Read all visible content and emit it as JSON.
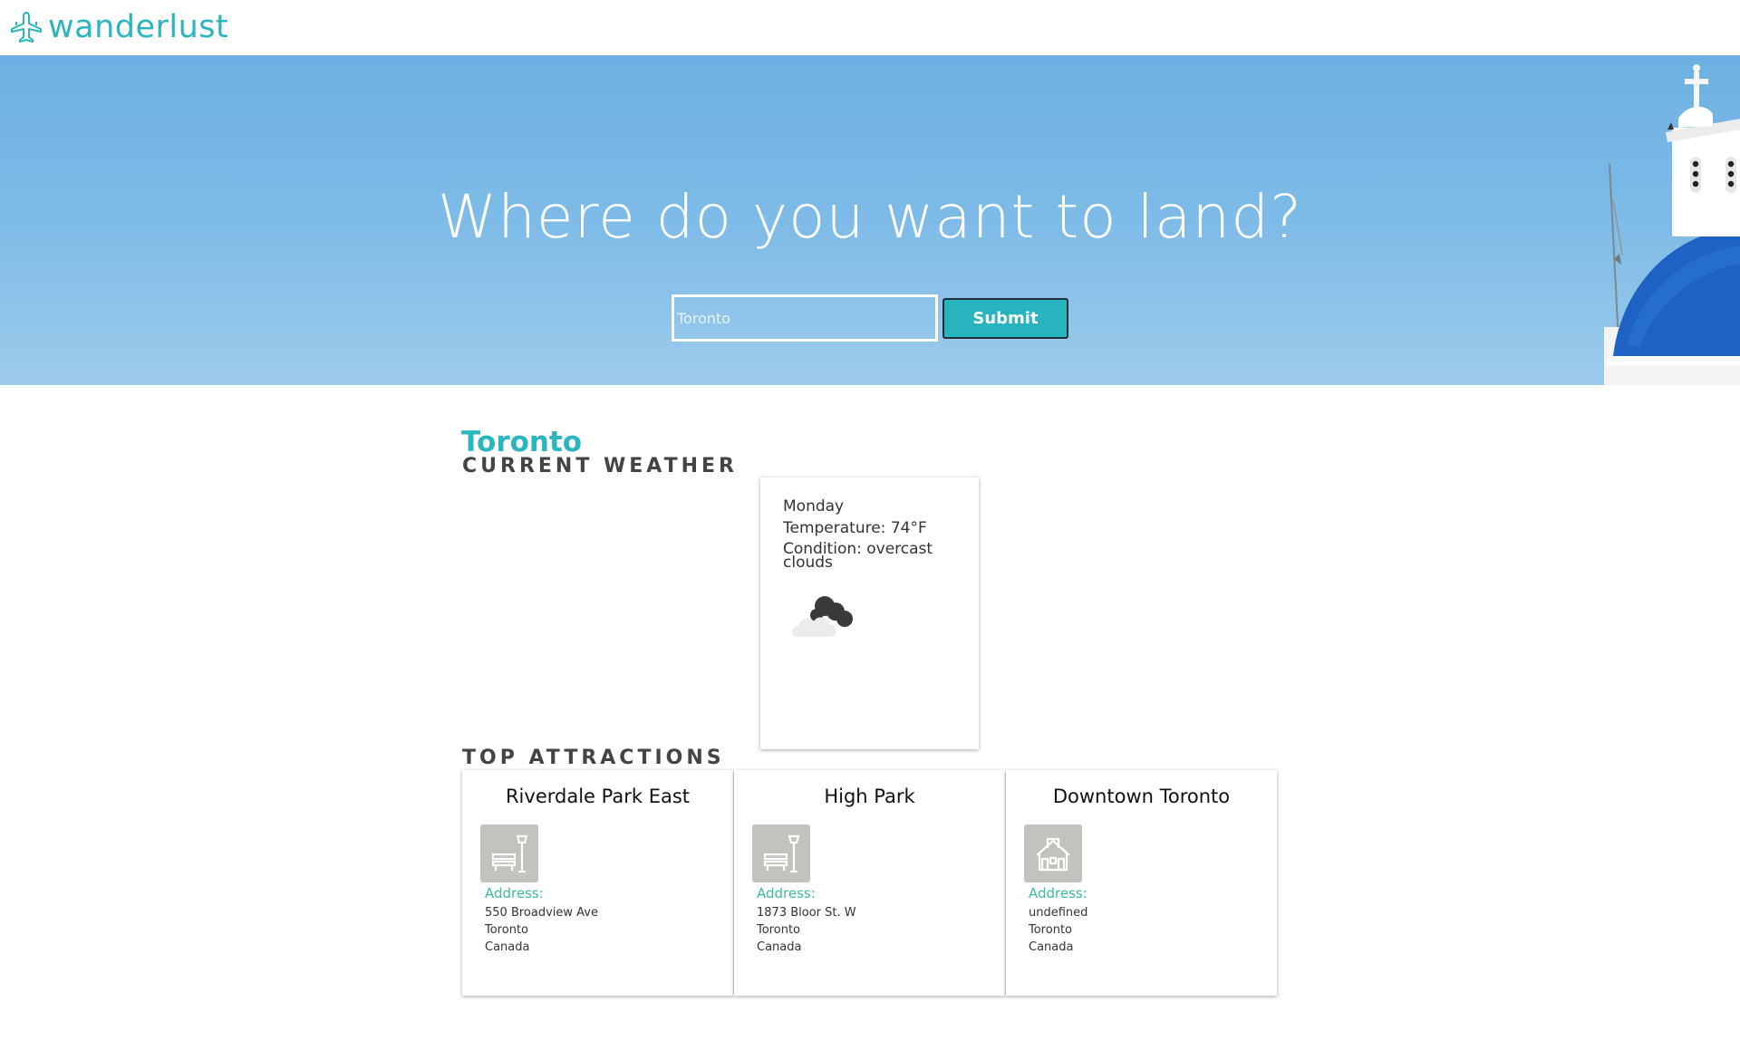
{
  "header": {
    "brand": "wanderlust",
    "logo_icon": "airplane-icon"
  },
  "hero": {
    "title": "Where do you want to land?",
    "search": {
      "value": "",
      "placeholder": "Toronto"
    },
    "submit_label": "Submit"
  },
  "result": {
    "city": "Toronto",
    "weather_heading": "CURRENT WEATHER",
    "weather": {
      "day": "Monday",
      "temperature": "Temperature: 74°F",
      "condition_line1": "Condition: overcast",
      "condition_line2": "clouds",
      "icon": "overcast-clouds-icon"
    },
    "attractions_heading": "TOP ATTRACTIONS",
    "attractions": [
      {
        "name": "Riverdale Park East",
        "icon": "park-bench-icon",
        "address_label": "Address:",
        "street": "550 Broadview Ave",
        "city": "Toronto",
        "country": "Canada"
      },
      {
        "name": "High Park",
        "icon": "park-bench-icon",
        "address_label": "Address:",
        "street": "1873 Bloor St. W",
        "city": "Toronto",
        "country": "Canada"
      },
      {
        "name": "Downtown Toronto",
        "icon": "neighborhood-house-icon",
        "address_label": "Address:",
        "street": "undefined",
        "city": "Toronto",
        "country": "Canada"
      }
    ]
  },
  "colors": {
    "accent": "#2bb6be",
    "address_label": "#3dbb9c",
    "hero_sky": "#7ebbe7",
    "icon_bg": "#c4c2bd"
  }
}
